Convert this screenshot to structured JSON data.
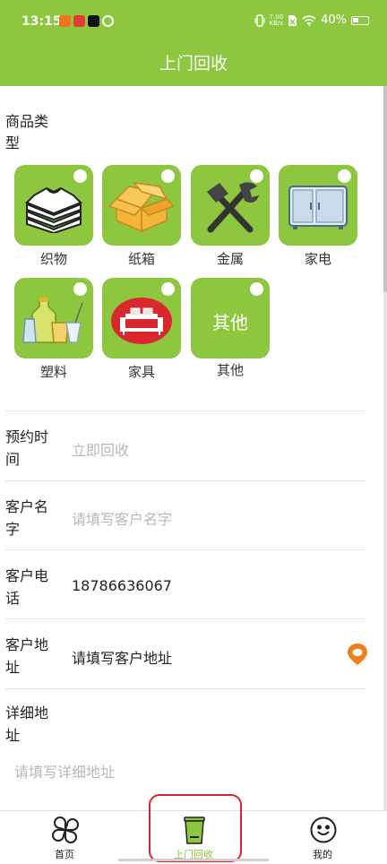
{
  "status_bar": {
    "time": "13:15",
    "net_speed_value": "7.00",
    "net_speed_unit": "KB/s",
    "battery": "40%"
  },
  "header": {
    "title": "上门回收"
  },
  "goods": {
    "label": "商品类型",
    "items": [
      {
        "label": "织物",
        "icon": "folded-clothes-icon"
      },
      {
        "label": "纸箱",
        "icon": "cardboard-box-icon"
      },
      {
        "label": "金属",
        "icon": "wrench-hammer-icon"
      },
      {
        "label": "家电",
        "icon": "refrigerator-icon"
      },
      {
        "label": "塑料",
        "icon": "plastic-bottles-icon"
      },
      {
        "label": "家具",
        "icon": "sofa-icon"
      },
      {
        "label": "其他",
        "tile_text": "其他"
      }
    ]
  },
  "form": {
    "appointment": {
      "label": "预约时间",
      "placeholder": "立即回收"
    },
    "name": {
      "label": "客户名字",
      "placeholder": "请填写客户名字"
    },
    "phone": {
      "label": "客户电话",
      "value": "18786636067"
    },
    "address": {
      "label": "客户地址",
      "value": "请填写客户地址",
      "icon": "location-pin-icon"
    },
    "detail": {
      "label": "详细地址",
      "placeholder": "请填写详细地址"
    }
  },
  "nav": {
    "items": [
      {
        "label": "首页",
        "icon": "clover-icon"
      },
      {
        "label": "上门回收",
        "icon": "bin-icon",
        "active": true
      },
      {
        "label": "我的",
        "icon": "smiley-icon"
      }
    ]
  },
  "colors": {
    "primary": "#8dc63f",
    "pin": "#f07f1b",
    "highlight": "#d9232e"
  }
}
